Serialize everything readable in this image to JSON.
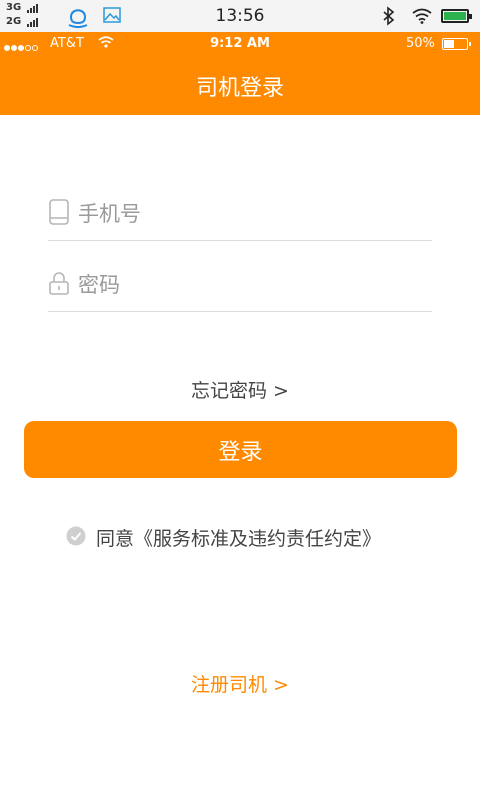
{
  "system_status": {
    "signal_top_label": "3G",
    "signal_bottom_label": "2G",
    "time": "13:56"
  },
  "ios_status": {
    "carrier": "AT&T",
    "time": "9:12 AM",
    "battery_percent": "50%",
    "battery_level": 0.5
  },
  "header": {
    "title": "司机登录"
  },
  "form": {
    "phone_placeholder": "手机号",
    "password_placeholder": "密码",
    "forgot_link": "忘记密码 >",
    "login_button": "登录",
    "agreement_text": "同意《服务标准及违约责任约定》"
  },
  "register_link": "注册司机 >",
  "colors": {
    "brand": "#ff8a00"
  }
}
